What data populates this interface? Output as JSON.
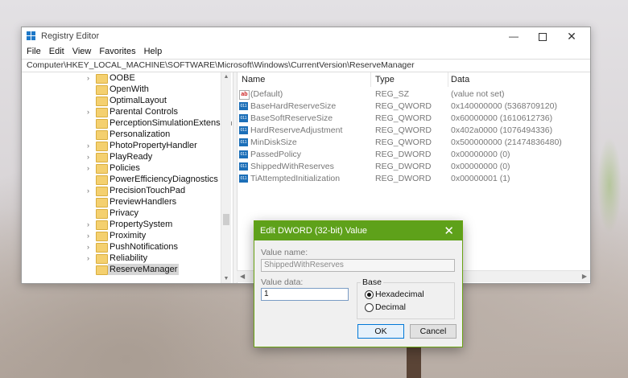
{
  "window": {
    "title": "Registry Editor",
    "buttons": {
      "minimize": "—",
      "close": "✕"
    }
  },
  "menu": [
    "File",
    "Edit",
    "View",
    "Favorites",
    "Help"
  ],
  "address": "Computer\\HKEY_LOCAL_MACHINE\\SOFTWARE\\Microsoft\\Windows\\CurrentVersion\\ReserveManager",
  "tree": {
    "items": [
      {
        "label": "OOBE",
        "expandable": true
      },
      {
        "label": "OpenWith",
        "expandable": false
      },
      {
        "label": "OptimalLayout",
        "expandable": false
      },
      {
        "label": "Parental Controls",
        "expandable": true
      },
      {
        "label": "PerceptionSimulationExtensions",
        "expandable": false
      },
      {
        "label": "Personalization",
        "expandable": false
      },
      {
        "label": "PhotoPropertyHandler",
        "expandable": true
      },
      {
        "label": "PlayReady",
        "expandable": true
      },
      {
        "label": "Policies",
        "expandable": true
      },
      {
        "label": "PowerEfficiencyDiagnostics",
        "expandable": false
      },
      {
        "label": "PrecisionTouchPad",
        "expandable": true
      },
      {
        "label": "PreviewHandlers",
        "expandable": false
      },
      {
        "label": "Privacy",
        "expandable": false
      },
      {
        "label": "PropertySystem",
        "expandable": true
      },
      {
        "label": "Proximity",
        "expandable": true
      },
      {
        "label": "PushNotifications",
        "expandable": true
      },
      {
        "label": "Reliability",
        "expandable": true
      },
      {
        "label": "ReserveManager",
        "expandable": false,
        "selected": true
      }
    ]
  },
  "values_table": {
    "headers": {
      "name": "Name",
      "type": "Type",
      "data": "Data"
    },
    "rows": [
      {
        "icon": "string",
        "name": "(Default)",
        "type": "REG_SZ",
        "data": "(value not set)"
      },
      {
        "icon": "binary",
        "name": "BaseHardReserveSize",
        "type": "REG_QWORD",
        "data": "0x140000000 (5368709120)"
      },
      {
        "icon": "binary",
        "name": "BaseSoftReserveSize",
        "type": "REG_QWORD",
        "data": "0x60000000 (1610612736)"
      },
      {
        "icon": "binary",
        "name": "HardReserveAdjustment",
        "type": "REG_QWORD",
        "data": "0x402a0000 (1076494336)"
      },
      {
        "icon": "binary",
        "name": "MinDiskSize",
        "type": "REG_QWORD",
        "data": "0x500000000 (21474836480)"
      },
      {
        "icon": "binary",
        "name": "PassedPolicy",
        "type": "REG_DWORD",
        "data": "0x00000000 (0)"
      },
      {
        "icon": "binary",
        "name": "ShippedWithReserves",
        "type": "REG_DWORD",
        "data": "0x00000000 (0)"
      },
      {
        "icon": "binary",
        "name": "TiAttemptedInitialization",
        "type": "REG_DWORD",
        "data": "0x00000001 (1)"
      }
    ]
  },
  "dialog": {
    "title": "Edit DWORD (32-bit) Value",
    "value_name_label": "Value name:",
    "value_name": "ShippedWithReserves",
    "value_data_label": "Value data:",
    "value_data": "1",
    "base_label": "Base",
    "hex_label": "Hexadecimal",
    "dec_label": "Decimal",
    "selected_base": "hexadecimal",
    "ok_label": "OK",
    "cancel_label": "Cancel",
    "accent_color": "#5ea11a"
  }
}
